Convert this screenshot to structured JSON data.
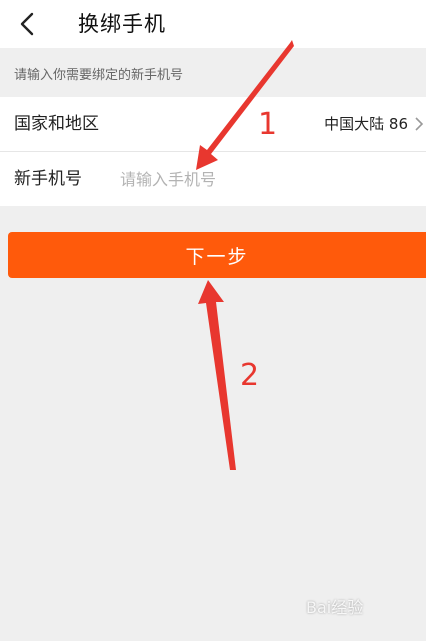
{
  "header": {
    "title": "换绑手机",
    "back_icon": "chevron-left-icon"
  },
  "hint": "请输入你需要绑定的新手机号",
  "form": {
    "region": {
      "label": "国家和地区",
      "value": "中国大陆 86",
      "icon": "chevron-right-icon"
    },
    "phone": {
      "label": "新手机号",
      "placeholder": "请输入手机号",
      "value": ""
    }
  },
  "next_button": {
    "label": "下一步",
    "color": "#ff5a0b"
  },
  "annotations": {
    "step1": "1",
    "step2": "2",
    "color": "#e8372f"
  },
  "watermark": "Bai经验"
}
